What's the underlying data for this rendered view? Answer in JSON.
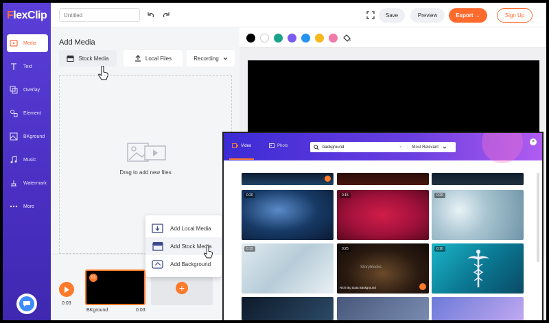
{
  "app": {
    "logo_lead": "F",
    "logo_rest": "lexClip"
  },
  "sidebar": {
    "items": [
      {
        "label": "Media",
        "icon": "media-icon",
        "active": true
      },
      {
        "label": "Text",
        "icon": "text-icon"
      },
      {
        "label": "Overlay",
        "icon": "overlay-icon"
      },
      {
        "label": "Element",
        "icon": "element-icon"
      },
      {
        "label": "BKground",
        "icon": "background-icon"
      },
      {
        "label": "Music",
        "icon": "music-icon"
      },
      {
        "label": "Watermark",
        "icon": "watermark-icon"
      },
      {
        "label": "More",
        "icon": "more-icon"
      }
    ]
  },
  "header": {
    "title_placeholder": "Untitled",
    "save_label": "Save",
    "preview_label": "Preview",
    "export_label": "Export →",
    "signup_label": "Sign Up"
  },
  "panel": {
    "title": "Add Media",
    "tabs": {
      "stock": "Stock Media",
      "local": "Local Files",
      "recording": "Recording"
    },
    "drop_text": "Drag to add new files"
  },
  "colors": {
    "swatches": [
      "#000000",
      "#ffffff",
      "#1aa38a",
      "#7b5cf0",
      "#2593f0",
      "#f6b81c",
      "#f27aa8"
    ],
    "accent": "#ff6b2d",
    "sidebar": "#4a2fc2"
  },
  "timeline": {
    "play_time": "0:03",
    "clip_number": "01",
    "clip_label": "BKground",
    "clip_duration": "0:03"
  },
  "context_menu": {
    "items": [
      "Add Local Media",
      "Add Stock Media",
      "Add Background"
    ]
  },
  "stock_modal": {
    "tabs": {
      "video": "Video",
      "photo": "Photo"
    },
    "search_value": "background",
    "sort_label": "Most Relevant",
    "close_label": "×",
    "thumbnails": [
      {
        "duration": "0:20",
        "caption": ""
      },
      {
        "duration": "0:15",
        "caption": ""
      },
      {
        "duration": "0:20",
        "caption": ""
      },
      {
        "duration": "0:15",
        "caption": ""
      },
      {
        "duration": "0:25",
        "caption": "Rich Big Data Background"
      },
      {
        "duration": "0:10",
        "caption": ""
      }
    ],
    "watermark_text": "Storyblocks"
  }
}
